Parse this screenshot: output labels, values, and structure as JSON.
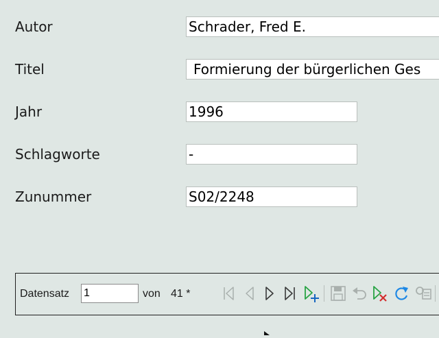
{
  "form": {
    "fields": [
      {
        "label": "Autor",
        "value": "Schrader, Fred E."
      },
      {
        "label": "Titel",
        "value": "Formierung der bürgerlichen Ges"
      },
      {
        "label": "Jahr",
        "value": "1996"
      },
      {
        "label": "Schlagworte",
        "value": "-"
      },
      {
        "label": "Zunummer",
        "value": "S02/2248"
      }
    ]
  },
  "navigation": {
    "record_label": "Datensatz",
    "record_value": "1",
    "of_label": "von",
    "total": "41 *",
    "icons": [
      "first-record-icon",
      "previous-record-icon",
      "next-record-icon",
      "last-record-icon",
      "new-record-icon",
      "save-record-icon",
      "undo-icon",
      "delete-record-icon",
      "refresh-icon",
      "find-record-icon"
    ],
    "colors": {
      "enabled_arrow": "#3a3a3a",
      "disabled": "#a9b0ad",
      "add_green": "#27a343",
      "add_plus": "#1565c0",
      "delete_red": "#d32f2f",
      "refresh_blue": "#1e88e5"
    }
  }
}
